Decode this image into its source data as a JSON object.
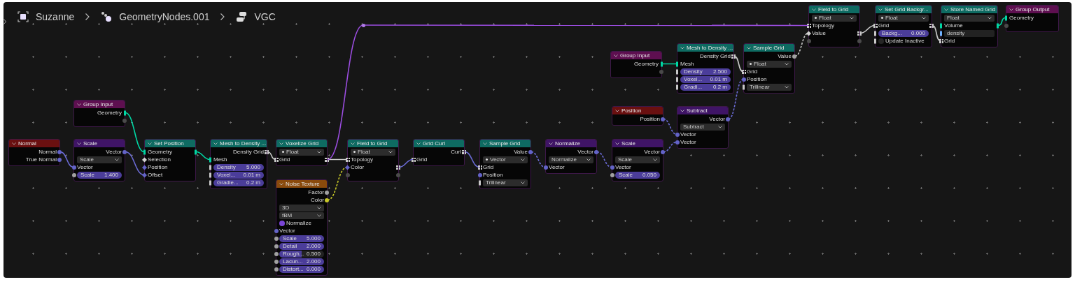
{
  "breadcrumb": [
    {
      "kind": "object",
      "label": "Suzanne"
    },
    {
      "kind": "modifier",
      "label": "GeometryNodes.001"
    },
    {
      "kind": "node-tree",
      "label": "VGC"
    }
  ],
  "nodes": [
    {
      "kind": "input",
      "title": "Normal",
      "rows": [
        {
          "kind": "socket",
          "label": "Normal",
          "out": {
            "kind": "vector"
          }
        },
        {
          "kind": "socket",
          "label": "True Normal",
          "out": {
            "kind": "vector"
          }
        }
      ]
    },
    {
      "kind": "group",
      "title": "Group Input",
      "rows": [
        {
          "kind": "socket",
          "label": "Geometry",
          "out": {
            "kind": "geometry"
          }
        },
        {
          "kind": "socket",
          "out": {
            "kind": "virtual"
          }
        }
      ]
    },
    {
      "kind": "vector",
      "title": "Scale",
      "rows": [
        {
          "kind": "socket",
          "label": "Vector",
          "out": {
            "kind": "vector"
          }
        },
        {
          "kind": "dropdown",
          "value": "Scale",
          "type_icon": false
        },
        {
          "kind": "socket",
          "label": "Vector",
          "in": {
            "kind": "vector"
          }
        },
        {
          "kind": "slider",
          "label": "Scale",
          "value": "1.400",
          "in": {
            "kind": "float"
          }
        }
      ]
    },
    {
      "kind": "geometry",
      "title": "Set Position",
      "rows": [
        {
          "kind": "socket",
          "label": "Geometry",
          "in": {
            "kind": "geometry"
          },
          "out": {
            "kind": "geometry"
          }
        },
        {
          "kind": "socket",
          "label": "Selection",
          "in": {
            "kind": "float-field"
          }
        },
        {
          "kind": "socket",
          "label": "Position",
          "in": {
            "kind": "vector-field"
          }
        },
        {
          "kind": "socket",
          "label": "Offset",
          "in": {
            "kind": "vector-field"
          }
        }
      ]
    },
    {
      "kind": "geometry",
      "title": "Mesh to Density ...",
      "rows": [
        {
          "kind": "socket",
          "label": "Density Grid",
          "out": {
            "kind": "grid"
          }
        },
        {
          "kind": "socket",
          "label": "Mesh",
          "in": {
            "kind": "geometry"
          }
        },
        {
          "kind": "slider",
          "label": "Density",
          "value": "5.000",
          "in": {
            "kind": "value"
          }
        },
        {
          "kind": "slider",
          "label": "Voxel...",
          "value": "0.01 m",
          "in": {
            "kind": "value"
          }
        },
        {
          "kind": "slider",
          "label": "Gradie...",
          "value": "0.2 m",
          "in": {
            "kind": "value"
          }
        }
      ]
    },
    {
      "kind": "geometry",
      "title": "Voxelize Grid",
      "rows": [
        {
          "kind": "dropdown",
          "value": "Float",
          "type_icon": true
        },
        {
          "kind": "socket",
          "label": "Grid",
          "in": {
            "kind": "grid"
          },
          "out": {
            "kind": "grid"
          }
        }
      ]
    },
    {
      "kind": "texture",
      "title": "Noise Texture",
      "rows": [
        {
          "kind": "socket",
          "label": "Factor",
          "out": {
            "kind": "float"
          }
        },
        {
          "kind": "socket",
          "label": "Color",
          "out": {
            "kind": "color"
          }
        },
        {
          "kind": "dropdown",
          "value": "3D",
          "type_icon": false
        },
        {
          "kind": "dropdown",
          "value": "fBM",
          "type_icon": false
        },
        {
          "kind": "checkbox",
          "label": "Normalize",
          "checked": true
        },
        {
          "kind": "socket",
          "label": "Vector",
          "in": {
            "kind": "vector"
          }
        },
        {
          "kind": "slider",
          "label": "Scale",
          "value": "5.000",
          "in": {
            "kind": "float"
          }
        },
        {
          "kind": "slider",
          "label": "Detail",
          "value": "2.000",
          "in": {
            "kind": "float"
          }
        },
        {
          "kind": "slider",
          "label": "Rough...",
          "value": "0.500",
          "in": {
            "kind": "float"
          },
          "level": 0.5
        },
        {
          "kind": "slider",
          "label": "Lacun...",
          "value": "2.000",
          "in": {
            "kind": "float"
          }
        },
        {
          "kind": "slider",
          "label": "Distort...",
          "value": "0.000",
          "in": {
            "kind": "float"
          }
        }
      ]
    },
    {
      "kind": "reroute"
    },
    {
      "kind": "geometry",
      "title": "Field to Grid",
      "rows": [
        {
          "kind": "dropdown",
          "value": "Float",
          "type_icon": true
        },
        {
          "kind": "socket",
          "label": "Topology",
          "in": {
            "kind": "grid"
          }
        },
        {
          "kind": "socket",
          "label": "Color",
          "in": {
            "kind": "vector-field"
          },
          "out": {
            "kind": "grid"
          }
        },
        {
          "kind": "socket",
          "in": {
            "kind": "virtual"
          },
          "out": {
            "kind": "virtual"
          }
        }
      ]
    },
    {
      "kind": "geometry",
      "title": "Grid Curl",
      "rows": [
        {
          "kind": "socket",
          "label": "Curl",
          "out": {
            "kind": "grid"
          }
        },
        {
          "kind": "socket",
          "label": "Grid",
          "in": {
            "kind": "grid"
          }
        }
      ]
    },
    {
      "kind": "geometry",
      "title": "Sample Grid",
      "rows": [
        {
          "kind": "socket",
          "label": "Value",
          "out": {
            "kind": "vector"
          }
        },
        {
          "kind": "dropdown",
          "value": "Vector",
          "type_icon": true
        },
        {
          "kind": "socket",
          "label": "Grid",
          "in": {
            "kind": "grid"
          }
        },
        {
          "kind": "socket",
          "label": "Position",
          "in": {
            "kind": "vector"
          }
        },
        {
          "kind": "dropdown",
          "value": "Trilinear",
          "type_icon": false,
          "in": {
            "kind": "value"
          }
        }
      ]
    },
    {
      "kind": "vector",
      "title": "Normalize",
      "rows": [
        {
          "kind": "socket",
          "label": "Vector",
          "out": {
            "kind": "vector"
          }
        },
        {
          "kind": "dropdown",
          "value": "Normalize",
          "type_icon": false
        },
        {
          "kind": "socket",
          "label": "Vector",
          "in": {
            "kind": "vector"
          }
        }
      ]
    },
    {
      "kind": "group",
      "title": "Group Input",
      "rows": [
        {
          "kind": "socket",
          "label": "Geometry",
          "out": {
            "kind": "geometry"
          }
        },
        {
          "kind": "socket",
          "out": {
            "kind": "virtual"
          }
        }
      ]
    },
    {
      "kind": "input",
      "title": "Position",
      "rows": [
        {
          "kind": "socket",
          "label": "Position",
          "out": {
            "kind": "vector"
          }
        }
      ]
    },
    {
      "kind": "vector",
      "title": "Scale",
      "rows": [
        {
          "kind": "socket",
          "label": "Vector",
          "out": {
            "kind": "vector"
          }
        },
        {
          "kind": "dropdown",
          "value": "Scale",
          "type_icon": false
        },
        {
          "kind": "socket",
          "label": "Vector",
          "in": {
            "kind": "vector"
          }
        },
        {
          "kind": "slider",
          "label": "Scale",
          "value": "0.050",
          "in": {
            "kind": "float"
          }
        }
      ]
    },
    {
      "kind": "geometry",
      "title": "Mesh to Density ...",
      "rows": [
        {
          "kind": "socket",
          "label": "Density Grid",
          "out": {
            "kind": "grid"
          }
        },
        {
          "kind": "socket",
          "label": "Mesh",
          "in": {
            "kind": "geometry"
          }
        },
        {
          "kind": "slider",
          "label": "Density",
          "value": "2.500",
          "in": {
            "kind": "value"
          }
        },
        {
          "kind": "slider",
          "label": "Voxel...",
          "value": "0.01 m",
          "in": {
            "kind": "value"
          }
        },
        {
          "kind": "slider",
          "label": "Gradi...",
          "value": "0.2 m",
          "in": {
            "kind": "value"
          }
        }
      ]
    },
    {
      "kind": "vector",
      "title": "Subtract",
      "rows": [
        {
          "kind": "socket",
          "label": "Vector",
          "out": {
            "kind": "vector"
          }
        },
        {
          "kind": "dropdown",
          "value": "Subtract",
          "type_icon": false
        },
        {
          "kind": "socket",
          "label": "Vector",
          "in": {
            "kind": "vector"
          }
        },
        {
          "kind": "socket",
          "label": "Vector",
          "in": {
            "kind": "vector"
          }
        }
      ]
    },
    {
      "kind": "geometry",
      "title": "Sample Grid",
      "rows": [
        {
          "kind": "socket",
          "label": "Value",
          "out": {
            "kind": "float"
          }
        },
        {
          "kind": "dropdown",
          "value": "Float",
          "type_icon": true
        },
        {
          "kind": "socket",
          "label": "Grid",
          "in": {
            "kind": "grid"
          }
        },
        {
          "kind": "socket",
          "label": "Position",
          "in": {
            "kind": "vector"
          }
        },
        {
          "kind": "dropdown",
          "value": "Trilinear",
          "type_icon": false,
          "in": {
            "kind": "value"
          }
        }
      ]
    },
    {
      "kind": "geometry",
      "title": "Field to Grid",
      "rows": [
        {
          "kind": "dropdown",
          "value": "Float",
          "type_icon": true
        },
        {
          "kind": "socket",
          "label": "Topology",
          "in": {
            "kind": "grid"
          }
        },
        {
          "kind": "socket",
          "label": "Value",
          "in": {
            "kind": "float-field"
          },
          "out": {
            "kind": "grid"
          }
        },
        {
          "kind": "socket",
          "in": {
            "kind": "virtual"
          },
          "out": {
            "kind": "virtual"
          }
        }
      ]
    },
    {
      "kind": "geometry",
      "title": "Set Grid Backgr...",
      "rows": [
        {
          "kind": "dropdown",
          "value": "Float",
          "type_icon": true
        },
        {
          "kind": "socket",
          "label": "Grid",
          "in": {
            "kind": "grid"
          },
          "out": {
            "kind": "grid"
          }
        },
        {
          "kind": "slider",
          "label": "Backg...",
          "value": "0.000",
          "in": {
            "kind": "value"
          }
        },
        {
          "kind": "checkbox",
          "label": "Update Inactive",
          "checked": false,
          "in": {
            "kind": "value"
          }
        }
      ]
    },
    {
      "kind": "geometry",
      "title": "Store Named Grid",
      "rows": [
        {
          "kind": "dropdown",
          "value": "Float",
          "type_icon": false
        },
        {
          "kind": "socket",
          "label": "Volume",
          "in": {
            "kind": "geometry"
          },
          "out": {
            "kind": "geometry"
          }
        },
        {
          "kind": "text",
          "value": "density",
          "in": {
            "kind": "string"
          }
        },
        {
          "kind": "socket",
          "label": "Grid",
          "in": {
            "kind": "grid"
          }
        }
      ]
    },
    {
      "kind": "group",
      "title": "Group Output",
      "rows": [
        {
          "kind": "socket",
          "label": "Geometry",
          "in": {
            "kind": "geometry"
          }
        },
        {
          "kind": "socket",
          "in": {
            "kind": "virtual"
          }
        }
      ]
    }
  ]
}
